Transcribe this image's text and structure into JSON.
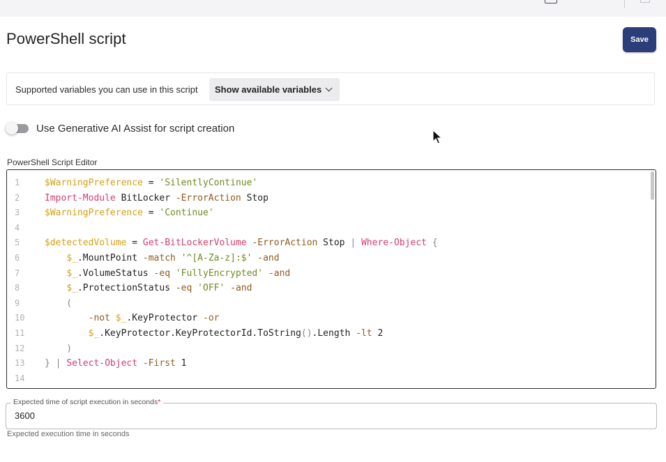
{
  "page": {
    "title": "PowerShell script",
    "save_label": "Save"
  },
  "variables": {
    "label": "Supported variables you can use in this script",
    "dropdown_label": "Show available variables"
  },
  "ai_assist": {
    "label": "Use Generative AI Assist for script creation",
    "enabled": false
  },
  "editor": {
    "label": "PowerShell Script Editor",
    "lines": [
      {
        "n": "1",
        "tokens": [
          {
            "t": "$WarningPreference",
            "c": "var"
          },
          {
            "t": " = ",
            "c": "plain"
          },
          {
            "t": "'SilentlyContinue'",
            "c": "str"
          }
        ]
      },
      {
        "n": "2",
        "tokens": [
          {
            "t": "Import-Module",
            "c": "cmd"
          },
          {
            "t": " BitLocker ",
            "c": "plain"
          },
          {
            "t": "-ErrorAction",
            "c": "param"
          },
          {
            "t": " Stop",
            "c": "plain"
          }
        ]
      },
      {
        "n": "3",
        "tokens": [
          {
            "t": "$WarningPreference",
            "c": "var"
          },
          {
            "t": " = ",
            "c": "plain"
          },
          {
            "t": "'Continue'",
            "c": "str"
          }
        ]
      },
      {
        "n": "4",
        "tokens": []
      },
      {
        "n": "5",
        "tokens": [
          {
            "t": "$detectedVolume",
            "c": "var"
          },
          {
            "t": " = ",
            "c": "plain"
          },
          {
            "t": "Get-BitLockerVolume",
            "c": "cmd"
          },
          {
            "t": " ",
            "c": "plain"
          },
          {
            "t": "-ErrorAction",
            "c": "param"
          },
          {
            "t": " Stop ",
            "c": "plain"
          },
          {
            "t": "|",
            "c": "punct"
          },
          {
            "t": " ",
            "c": "plain"
          },
          {
            "t": "Where-Object",
            "c": "cmd"
          },
          {
            "t": " {",
            "c": "punct"
          }
        ]
      },
      {
        "n": "6",
        "tokens": [
          {
            "t": "    ",
            "c": "plain"
          },
          {
            "t": "$_",
            "c": "var"
          },
          {
            "t": ".MountPoint ",
            "c": "plain"
          },
          {
            "t": "-match",
            "c": "param"
          },
          {
            "t": " ",
            "c": "plain"
          },
          {
            "t": "'^[A-Za-z]:$'",
            "c": "str"
          },
          {
            "t": " ",
            "c": "plain"
          },
          {
            "t": "-and",
            "c": "param"
          }
        ]
      },
      {
        "n": "7",
        "tokens": [
          {
            "t": "    ",
            "c": "plain"
          },
          {
            "t": "$_",
            "c": "var"
          },
          {
            "t": ".VolumeStatus ",
            "c": "plain"
          },
          {
            "t": "-eq",
            "c": "param"
          },
          {
            "t": " ",
            "c": "plain"
          },
          {
            "t": "'FullyEncrypted'",
            "c": "str"
          },
          {
            "t": " ",
            "c": "plain"
          },
          {
            "t": "-and",
            "c": "param"
          }
        ]
      },
      {
        "n": "8",
        "tokens": [
          {
            "t": "    ",
            "c": "plain"
          },
          {
            "t": "$_",
            "c": "var"
          },
          {
            "t": ".ProtectionStatus ",
            "c": "plain"
          },
          {
            "t": "-eq",
            "c": "param"
          },
          {
            "t": " ",
            "c": "plain"
          },
          {
            "t": "'OFF'",
            "c": "str"
          },
          {
            "t": " ",
            "c": "plain"
          },
          {
            "t": "-and",
            "c": "param"
          }
        ]
      },
      {
        "n": "9",
        "tokens": [
          {
            "t": "    (",
            "c": "punct"
          }
        ]
      },
      {
        "n": "10",
        "tokens": [
          {
            "t": "        ",
            "c": "plain"
          },
          {
            "t": "-not",
            "c": "param"
          },
          {
            "t": " ",
            "c": "plain"
          },
          {
            "t": "$_",
            "c": "var"
          },
          {
            "t": ".KeyProtector ",
            "c": "plain"
          },
          {
            "t": "-or",
            "c": "param"
          }
        ]
      },
      {
        "n": "11",
        "tokens": [
          {
            "t": "        ",
            "c": "plain"
          },
          {
            "t": "$_",
            "c": "var"
          },
          {
            "t": ".KeyProtector.KeyProtectorId.ToString",
            "c": "plain"
          },
          {
            "t": "()",
            "c": "punct"
          },
          {
            "t": ".Length ",
            "c": "plain"
          },
          {
            "t": "-lt",
            "c": "param"
          },
          {
            "t": " 2",
            "c": "plain"
          }
        ]
      },
      {
        "n": "12",
        "tokens": [
          {
            "t": "    )",
            "c": "punct"
          }
        ]
      },
      {
        "n": "13",
        "tokens": [
          {
            "t": "}",
            "c": "punct"
          },
          {
            "t": " ",
            "c": "plain"
          },
          {
            "t": "|",
            "c": "punct"
          },
          {
            "t": " ",
            "c": "plain"
          },
          {
            "t": "Select-Object",
            "c": "cmd"
          },
          {
            "t": " ",
            "c": "plain"
          },
          {
            "t": "-First",
            "c": "param"
          },
          {
            "t": " 1",
            "c": "plain"
          }
        ]
      },
      {
        "n": "14",
        "tokens": []
      }
    ]
  },
  "execution_time": {
    "label": "Expected time of script execution in seconds",
    "required_mark": "*",
    "value": "3600",
    "help": "Expected execution time in seconds"
  },
  "colors": {
    "save_button": "#2c3e7a",
    "variable": "#d4a017",
    "string": "#6e8a1f",
    "command": "#d23f6c",
    "parameter": "#8f5a1e"
  }
}
